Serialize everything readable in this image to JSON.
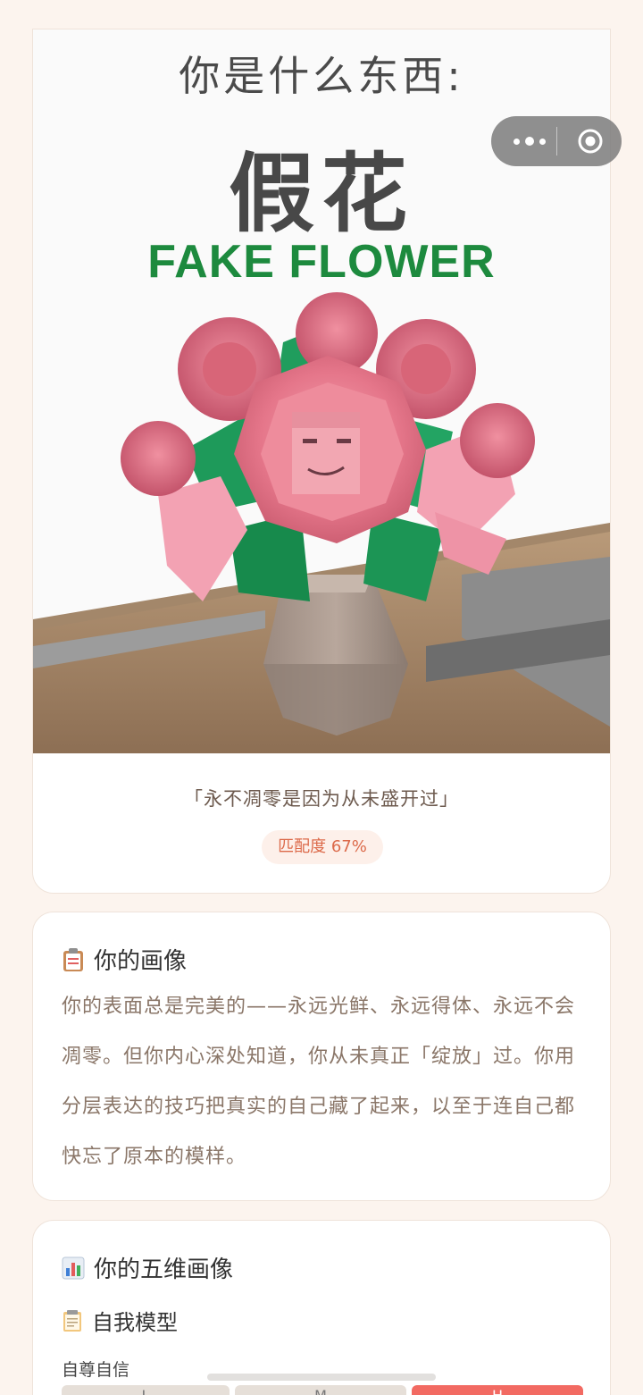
{
  "result": {
    "question": "你是什么东西:",
    "title": "假花",
    "subtitle": "FAKE FLOWER",
    "quote": "「永不凋零是因为从未盛开过」",
    "match_label": "匹配度 67%",
    "match_value": 67
  },
  "portrait": {
    "icon": "clipboard-icon",
    "heading": "你的画像",
    "text": "你的表面总是完美的——永远光鲜、永远得体、永远不会凋零。但你内心深处知道，你从未真正「绽放」过。你用分层表达的技巧把真实的自己藏了起来，以至于连自己都快忘了原本的模样。"
  },
  "dimensions": {
    "icon": "bar-chart-icon",
    "heading": "你的五维画像",
    "section_icon": "notepad-icon",
    "section_title": "自我模型",
    "items": [
      {
        "label": "自尊自信",
        "levels": [
          "L",
          "M",
          "H"
        ],
        "selected": "H"
      }
    ]
  },
  "colors": {
    "background": "#fcf4ee",
    "accent": "#dc6a4a",
    "title_green": "#1d8a3e",
    "selected_level": "#f26a62"
  }
}
